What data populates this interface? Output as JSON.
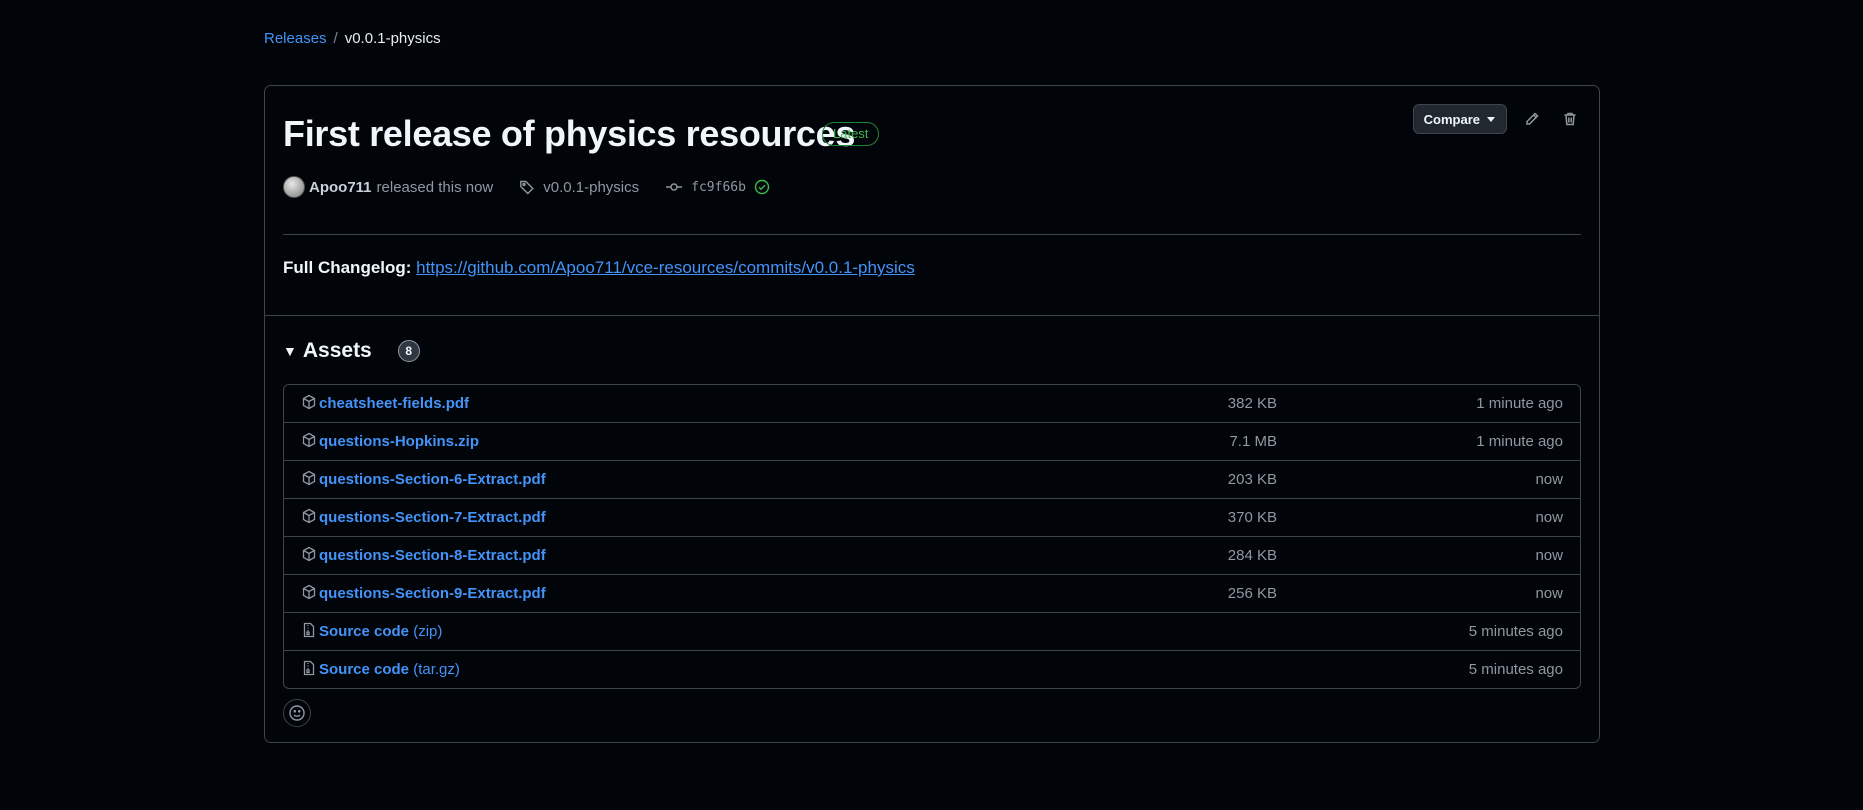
{
  "breadcrumb": {
    "parent": "Releases",
    "separator": "/",
    "current": "v0.0.1-physics"
  },
  "release": {
    "title": "First release of physics resources",
    "badge": "Latest",
    "compare_label": "Compare",
    "author": "Apoo711",
    "released_text": "released this now",
    "tag": "v0.0.1-physics",
    "commit": "fc9f66b",
    "changelog_label": "Full Changelog:",
    "changelog_url": "https://github.com/Apoo711/vce-resources/commits/v0.0.1-physics"
  },
  "assets": {
    "title": "Assets",
    "count": "8",
    "rows": [
      {
        "icon": "package-icon",
        "name": "cheatsheet-fields.pdf",
        "suffix": "",
        "size": "382 KB",
        "time": "1 minute ago"
      },
      {
        "icon": "package-icon",
        "name": "questions-Hopkins.zip",
        "suffix": "",
        "size": "7.1 MB",
        "time": "1 minute ago"
      },
      {
        "icon": "package-icon",
        "name": "questions-Section-6-Extract.pdf",
        "suffix": "",
        "size": "203 KB",
        "time": "now"
      },
      {
        "icon": "package-icon",
        "name": "questions-Section-7-Extract.pdf",
        "suffix": "",
        "size": "370 KB",
        "time": "now"
      },
      {
        "icon": "package-icon",
        "name": "questions-Section-8-Extract.pdf",
        "suffix": "",
        "size": "284 KB",
        "time": "now"
      },
      {
        "icon": "package-icon",
        "name": "questions-Section-9-Extract.pdf",
        "suffix": "",
        "size": "256 KB",
        "time": "now"
      },
      {
        "icon": "file-zip-icon",
        "name": "Source code",
        "suffix": " (zip)",
        "size": "",
        "time": "5 minutes ago"
      },
      {
        "icon": "file-zip-icon",
        "name": "Source code",
        "suffix": " (tar.gz)",
        "size": "",
        "time": "5 minutes ago"
      }
    ]
  },
  "colors": {
    "background": "#010409",
    "border": "#3d444d",
    "link": "#4493f8",
    "success": "#3fb950"
  }
}
